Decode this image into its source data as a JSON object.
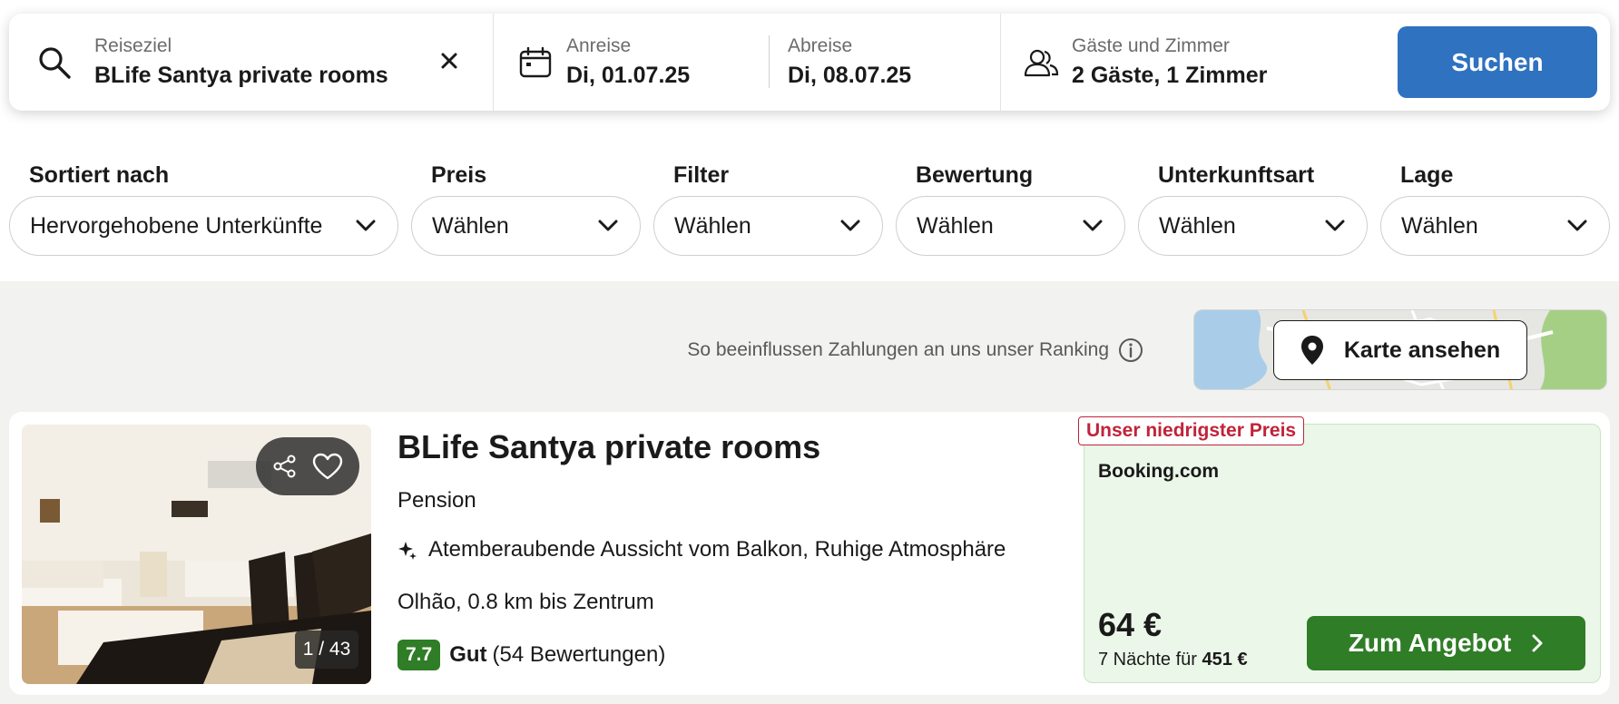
{
  "search": {
    "destination_label": "Reiseziel",
    "destination_value": "BLife Santya private rooms",
    "checkin_label": "Anreise",
    "checkin_value": "Di, 01.07.25",
    "checkout_label": "Abreise",
    "checkout_value": "Di, 08.07.25",
    "guests_label": "Gäste und Zimmer",
    "guests_value": "2 Gäste, 1 Zimmer",
    "search_button": "Suchen"
  },
  "filters": [
    {
      "label": "Sortiert nach",
      "value": "Hervorgehobene Unterkünfte"
    },
    {
      "label": "Preis",
      "value": "Wählen"
    },
    {
      "label": "Filter",
      "value": "Wählen"
    },
    {
      "label": "Bewertung",
      "value": "Wählen"
    },
    {
      "label": "Unterkunftsart",
      "value": "Wählen"
    },
    {
      "label": "Lage",
      "value": "Wählen"
    }
  ],
  "ranking_note": "So beeinflussen Zahlungen an uns unser Ranking",
  "map_button": "Karte ansehen",
  "hotel": {
    "name": "BLife Santya private rooms",
    "type": "Pension",
    "feature": "Atemberaubende Aussicht vom Balkon, Ruhige Atmosphäre",
    "location": "Olhão, 0.8 km bis Zentrum",
    "score": "7.7",
    "rating_word": "Gut",
    "reviews": "(54 Bewertungen)",
    "photo_counter": "1 / 43",
    "badge": "Unser niedrigster Preis",
    "provider": "Booking.com",
    "price": "64 €",
    "price_detail_prefix": "7 Nächte für",
    "price_total": "451 €",
    "offer_button": "Zum Angebot"
  },
  "colors": {
    "primary_blue": "#2e72c0",
    "deal_green": "#2f7d26",
    "badge_red": "#c0233a",
    "offer_bg": "#ebf7e9"
  }
}
